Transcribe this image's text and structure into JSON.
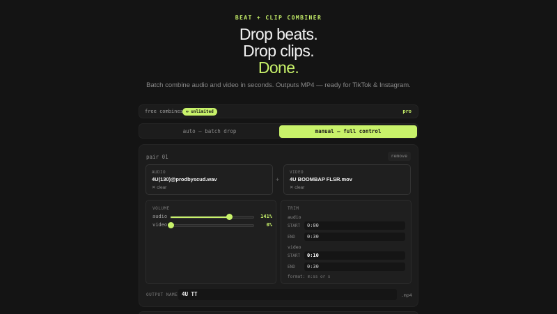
{
  "header": {
    "eyebrow": "BEAT + CLIP COMBINER",
    "hero_lines": [
      "Drop beats.",
      "Drop clips.",
      "Done."
    ],
    "subtitle": "Batch combine audio and video in seconds. Outputs MP4 — ready for TikTok & Instagram."
  },
  "freebar": {
    "label": "free combines",
    "badge": "∞ unlimited",
    "pro": "pro"
  },
  "mode_toggle": {
    "auto_label": "auto — batch drop",
    "manual_label": "manual — full control",
    "selected": "manual"
  },
  "pair": {
    "title": "pair 01",
    "remove_label": "remove",
    "audio": {
      "kind": "AUDIO",
      "filename": "4U(130)@prodbyscud.wav",
      "clear_label": "✕ clear"
    },
    "plus": "+",
    "video": {
      "kind": "VIDEO",
      "filename": "4U BOOMBAP FLSR.mov",
      "clear_label": "✕ clear"
    },
    "volume": {
      "title": "VOLUME",
      "audio": {
        "label": "audio",
        "value_text": "141%",
        "level": 0.705
      },
      "video": {
        "label": "video",
        "value_text": "0%",
        "level": 0.0
      }
    },
    "trim": {
      "title": "TRIM",
      "audio": {
        "label": "audio",
        "start_label": "START",
        "start": "0:00",
        "end_label": "END",
        "end": "0:30"
      },
      "video": {
        "label": "video",
        "start_label": "START",
        "start": "0:10",
        "end_label": "END",
        "end": "0:30"
      },
      "hint": "format: m:ss or s"
    },
    "output": {
      "label": "OUTPUT NAME",
      "value": "4U TT",
      "extension": ".mp4"
    }
  },
  "colors": {
    "accent": "#c8f26a",
    "background": "#141414",
    "panel": "#1c1c1c"
  }
}
